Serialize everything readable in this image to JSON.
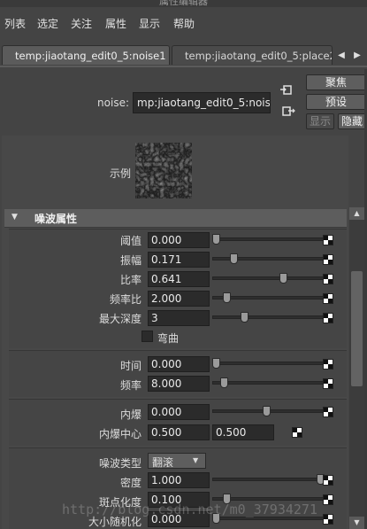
{
  "title": "属性编辑器",
  "menu": [
    "列表",
    "选定",
    "关注",
    "属性",
    "显示",
    "帮助"
  ],
  "tabs": [
    {
      "label": "temp:jiaotang_edit0_5:noise1",
      "active": true
    },
    {
      "label": "temp:jiaotang_edit0_5:place2d",
      "active": false
    }
  ],
  "node": {
    "label": "noise:",
    "value": "mp:jiaotang_edit0_5:noise1"
  },
  "buttons": {
    "focus": "聚焦",
    "preset": "预设",
    "show": "显示",
    "hide": "隐藏"
  },
  "sample_label": "示例",
  "section_title": "噪波属性",
  "attrs": [
    {
      "label": "阈值",
      "value": "0.000",
      "slider": 0.0
    },
    {
      "label": "振幅",
      "value": "0.171",
      "slider": 0.171
    },
    {
      "label": "比率",
      "value": "0.641",
      "slider": 0.641
    },
    {
      "label": "频率比",
      "value": "2.000",
      "slider": 0.1
    },
    {
      "label": "最大深度",
      "value": "3",
      "slider": 0.27
    }
  ],
  "inflection_label": "弯曲",
  "time": {
    "label": "时间",
    "value": "0.000",
    "slider": 0.0
  },
  "frequency": {
    "label": "频率",
    "value": "8.000",
    "slider": 0.08
  },
  "implode": {
    "label": "内爆",
    "value": "0.000",
    "slider": 0.48
  },
  "implode_center": {
    "label": "内爆中心",
    "x": "0.500",
    "y": "0.500"
  },
  "noise_type": {
    "label": "噪波类型",
    "value": "翻滚"
  },
  "density": {
    "label": "密度",
    "value": "1.000",
    "slider": 1.0
  },
  "spottyness": {
    "label": "斑点化度",
    "value": "0.100",
    "slider": 0.1
  },
  "size_rand": {
    "label": "大小随机化",
    "value": "0.000",
    "slider": 0.0
  },
  "watermark": "http://blog.csdn.net/m0_37934271"
}
